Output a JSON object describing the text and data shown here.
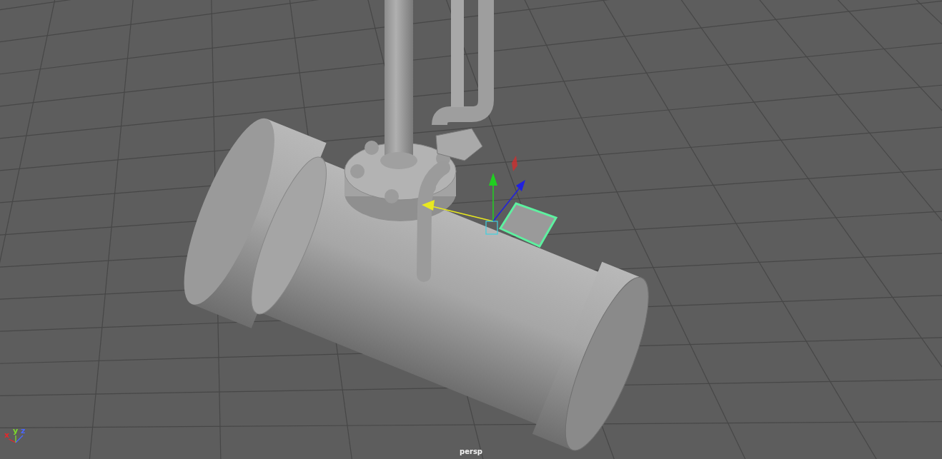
{
  "viewport": {
    "camera_label": "persp",
    "axis_labels": [
      {
        "text": "x",
        "color": "#e8262a"
      },
      {
        "text": "y",
        "color": "#7ddc2a"
      },
      {
        "text": "z",
        "color": "#4a66ff"
      }
    ]
  }
}
